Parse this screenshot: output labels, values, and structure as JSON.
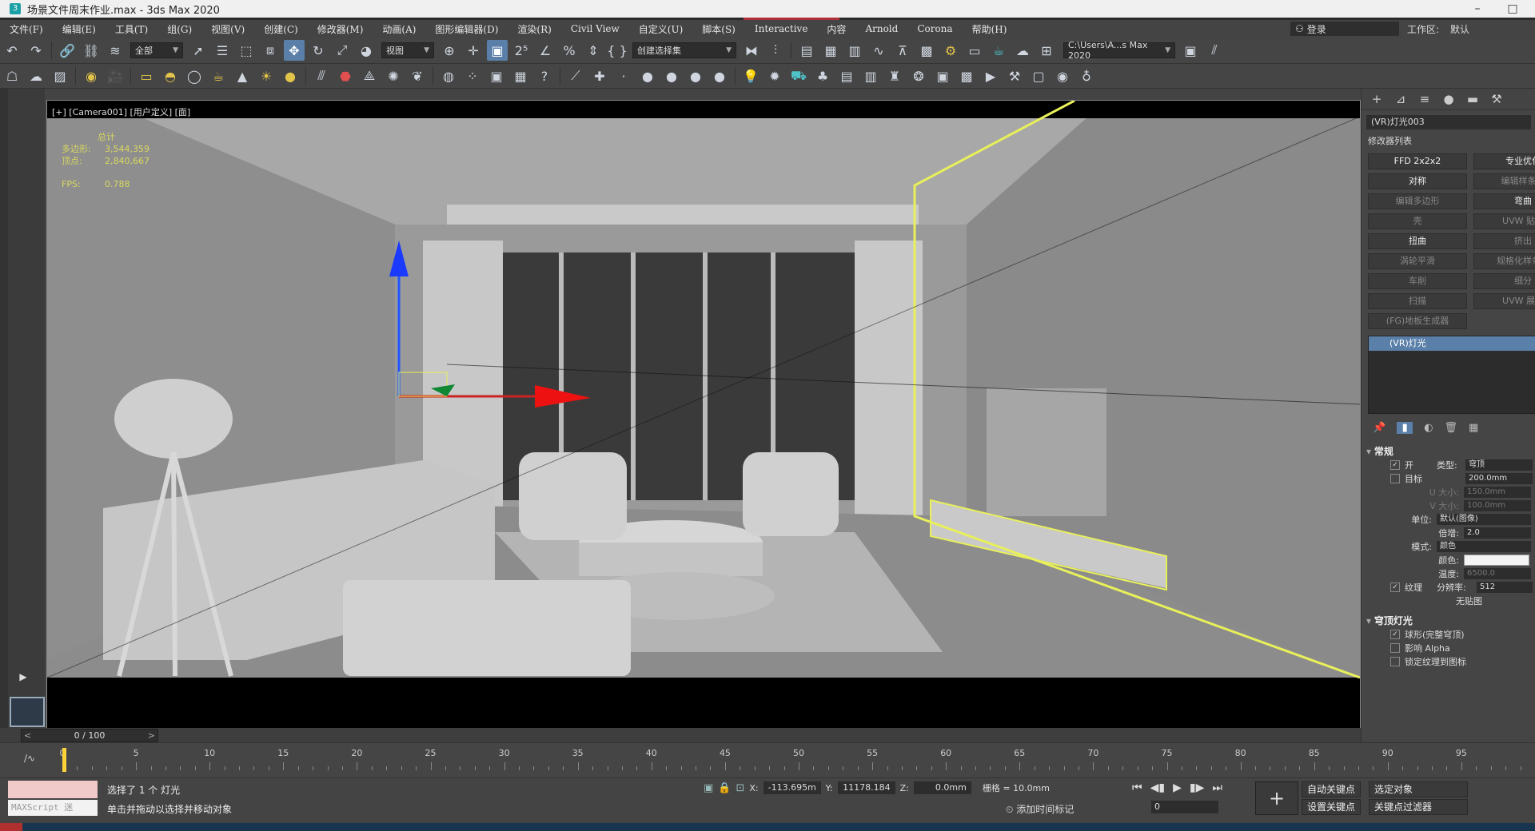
{
  "window": {
    "title": "场景文件周末作业.max - 3ds Max 2020",
    "app_icon": "3",
    "controls": [
      "–",
      "□"
    ]
  },
  "menu": {
    "items": [
      "文件(F)",
      "编辑(E)",
      "工具(T)",
      "组(G)",
      "视图(V)",
      "创建(C)",
      "修改器(M)",
      "动画(A)",
      "图形编辑器(D)",
      "渲染(R)",
      "Civil View",
      "自定义(U)",
      "脚本(S)",
      "Interactive",
      "内容",
      "Arnold",
      "Corona",
      "帮助(H)"
    ],
    "login": "登录",
    "workspace_label": "工作区:",
    "workspace_value": "默认"
  },
  "toolbar1": {
    "selection_filter": "全部",
    "ref_coord": "视图",
    "named_selection": "创建选择集",
    "project_path": "C:\\Users\\A...s Max 2020"
  },
  "viewport": {
    "label": "[+] [Camera001] [用户定义] [面]",
    "stats": {
      "header": "总计",
      "polys_label": "多边形:",
      "polys_value": "3,544,359",
      "verts_label": "顶点:",
      "verts_value": "2,840,667",
      "fps_label": "FPS:",
      "fps_value": "0.788"
    }
  },
  "command_panel": {
    "object_name": "(VR)灯光003",
    "modifier_list_label": "修改器列表",
    "modifier_buttons": [
      {
        "label": "FFD 2x2x2",
        "dim": false
      },
      {
        "label": "专业优化",
        "dim": false
      },
      {
        "label": "对称",
        "dim": false
      },
      {
        "label": "编辑样条线",
        "dim": true
      },
      {
        "label": "编辑多边形",
        "dim": true
      },
      {
        "label": "弯曲",
        "dim": false
      },
      {
        "label": "壳",
        "dim": true
      },
      {
        "label": "UVW 贴图",
        "dim": true
      },
      {
        "label": "扭曲",
        "dim": false
      },
      {
        "label": "挤出",
        "dim": true
      },
      {
        "label": "涡轮平滑",
        "dim": true
      },
      {
        "label": "规格化样条线",
        "dim": true
      },
      {
        "label": "车削",
        "dim": true
      },
      {
        "label": "细分",
        "dim": true
      },
      {
        "label": "扫描",
        "dim": true
      },
      {
        "label": "UVW 展开",
        "dim": true
      }
    ],
    "floor_generator": "(FG)地板生成器",
    "stack_item": "(VR)灯光",
    "rollout_general": "常规",
    "on_label": "开",
    "type_label": "类型:",
    "type_value": "穹顶",
    "target_label": "目标",
    "target_value": "200.0mm",
    "u_size_label": "U 大小:",
    "u_size_value": "150.0mm",
    "v_size_label": "V 大小:",
    "v_size_value": "100.0mm",
    "units_label": "单位:",
    "units_value": "默认(图像)",
    "multiplier_label": "倍增:",
    "multiplier_value": "2.0",
    "mode_label": "模式:",
    "mode_value": "颜色",
    "color_label": "颜色:",
    "temp_label": "温度:",
    "temp_value": "6500.0",
    "texture_label": "纹理",
    "resolution_label": "分辨率:",
    "resolution_value": "512",
    "no_map": "无贴图",
    "rollout_dome": "穹顶灯光",
    "spherical": "球形(完整穹顶)",
    "affect_alpha": "影响 Alpha",
    "lock_texture": "锁定纹理到图标"
  },
  "timeline": {
    "slider_text": "0 / 100",
    "ticks": [
      0,
      5,
      10,
      15,
      20,
      25,
      30,
      35,
      40,
      45,
      50,
      55,
      60,
      65,
      70,
      75,
      80,
      85,
      90,
      95
    ],
    "current": 0
  },
  "status": {
    "maxscript": "MAXScript 迷",
    "line1": "选择了 1 个 灯光",
    "line2": "单击并拖动以选择并移动对象",
    "x_label": "X:",
    "x_value": "-113.695m",
    "y_label": "Y:",
    "y_value": "11178.184",
    "z_label": "Z:",
    "z_value": "0.0mm",
    "grid_label": "栅格 = 10.0mm",
    "add_time_tag": "添加时间标记",
    "frame_value": "0",
    "auto_key": "自动关键点",
    "set_key": "设置关键点",
    "selected_object": "选定对象",
    "key_filters": "关键点过滤器"
  },
  "colors": {
    "accent": "#5a7fa8",
    "selection_yellow": "#e8f05a",
    "viewport_border": "#d8e050"
  }
}
